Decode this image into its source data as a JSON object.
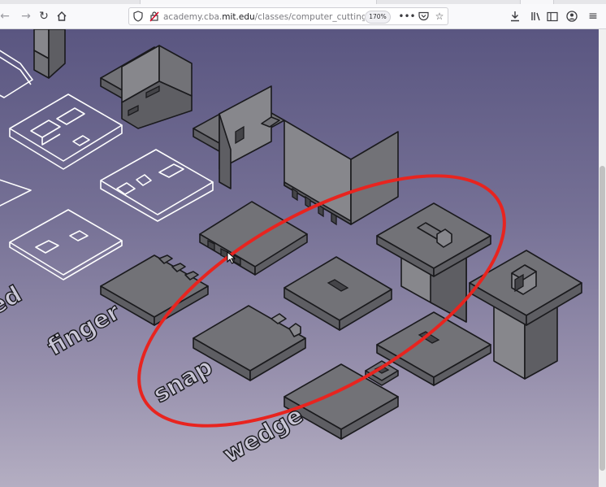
{
  "browser": {
    "url_prefix": "academy.cba.",
    "url_host": "mit.edu",
    "url_path": "/classes/computer_cutting/joint…",
    "zoom": "170%",
    "icons": {
      "back": "back-arrow-icon",
      "forward": "forward-arrow-icon",
      "reload": "reload-icon",
      "home": "home-icon",
      "tracking": "tracking-protection-shield-icon",
      "insecure": "insecure-lock-icon",
      "page_actions": "more-icon",
      "pocket": "pocket-icon",
      "bookmark": "bookmark-star-icon",
      "downloads": "download-icon",
      "library": "library-icon",
      "sidebar": "sidebar-icon",
      "account": "account-icon",
      "menu": "hamburger-menu-icon"
    }
  },
  "page": {
    "labels": {
      "partial_left": "ed",
      "finger": "finger",
      "snap": "snap",
      "wedge": "wedge"
    },
    "colors": {
      "background_top": "#5a5681",
      "background_bottom": "#b4aec2",
      "part_fill": "#727277",
      "outline_fill": "#ffffff",
      "annotation_ellipse": "#e8241f"
    }
  }
}
